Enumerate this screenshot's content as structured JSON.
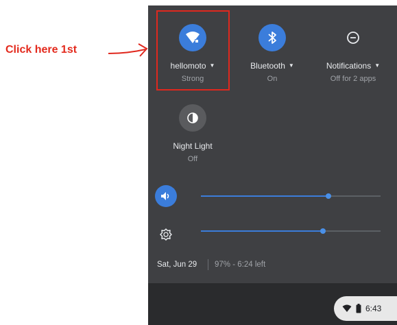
{
  "annotation": {
    "text": "Click here 1st",
    "color": "#e32a1d"
  },
  "tiles": {
    "network": {
      "label": "hellomoto",
      "sub": "Strong",
      "icon": "wifi-secure-icon"
    },
    "bluetooth": {
      "label": "Bluetooth",
      "sub": "On",
      "icon": "bluetooth-icon"
    },
    "notifications": {
      "label": "Notifications",
      "sub": "Off for 2 apps",
      "icon": "do-not-disturb-icon"
    },
    "night_light": {
      "label": "Night Light",
      "sub": "Off",
      "icon": "night-light-icon"
    }
  },
  "sliders": {
    "volume": {
      "icon": "volume-icon",
      "level": 0.71
    },
    "brightness": {
      "icon": "brightness-icon",
      "level": 0.68
    }
  },
  "footer": {
    "date": "Sat, Jun 29",
    "battery": "97% - 6:24 left"
  },
  "tray": {
    "time": "6:43"
  },
  "colors": {
    "panel": "#3f4043",
    "accent": "#3b7ddb",
    "annotation": "#e32a1d"
  }
}
